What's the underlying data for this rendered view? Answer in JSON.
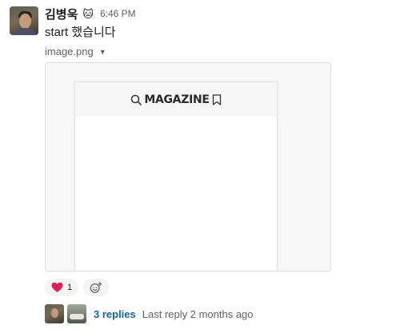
{
  "message": {
    "sender": "김병욱",
    "status_emoji": "🐱",
    "time": "6:46 PM",
    "text": "start 했습니다"
  },
  "attachment": {
    "filename": "image.png",
    "preview_title": "MAGAZINE"
  },
  "reactions": [
    {
      "emoji": "❤️",
      "count": "1"
    }
  ],
  "thread": {
    "replies": "3 replies",
    "last_reply": "Last reply 2 months ago"
  },
  "colors": {
    "link": "#1264a3",
    "muted": "#616061",
    "heart": "#e01e5a"
  }
}
